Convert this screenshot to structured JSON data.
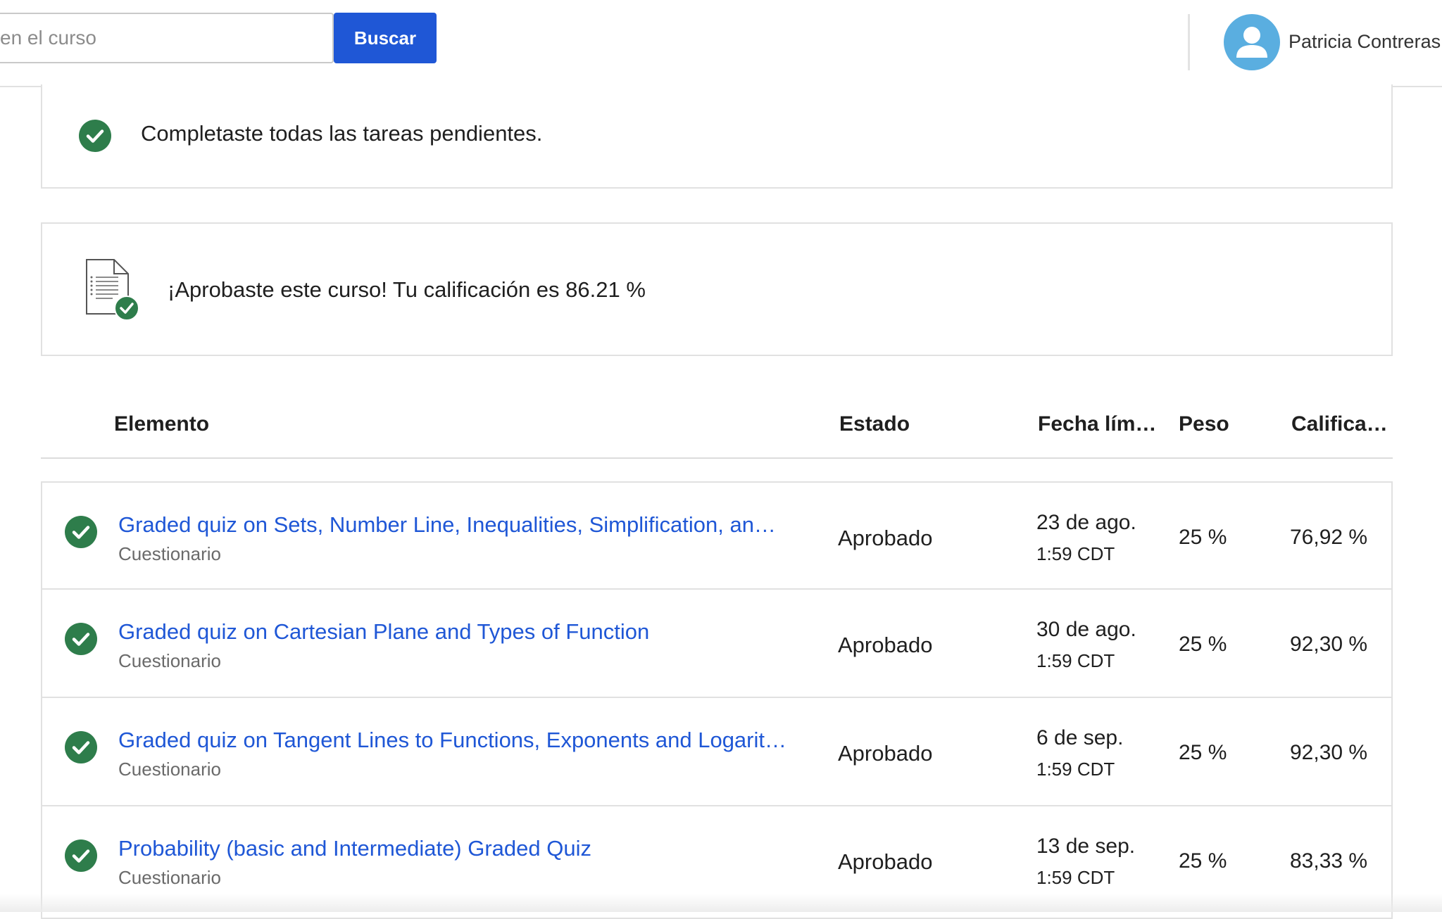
{
  "header": {
    "search_placeholder": "en el curso",
    "search_button": "Buscar",
    "user_name": "Patricia Contreras",
    "avatar_icon": "user-avatar-icon",
    "avatar_color": "#5aaee0"
  },
  "notices": {
    "tasks_message": "Completaste todas las tareas pendientes.",
    "pass_message": "¡Aprobaste este curso! Tu calificación es 86.21 %",
    "check_icon": "check-circle-icon",
    "document_icon": "document-check-icon",
    "success_color": "#2e7d4b"
  },
  "table": {
    "columns": {
      "item": "Elemento",
      "status": "Estado",
      "due": "Fecha lím…",
      "weight": "Peso",
      "grade": "Califica…"
    },
    "rows": [
      {
        "title": "Graded quiz on Sets, Number Line, Inequalities, Simplification, an…",
        "type": "Cuestionario",
        "status": "Aprobado",
        "date": "23 de ago.",
        "time": "1:59 CDT",
        "weight": "25 %",
        "grade": "76,92 %"
      },
      {
        "title": "Graded quiz on Cartesian Plane and Types of Function",
        "type": "Cuestionario",
        "status": "Aprobado",
        "date": "30 de ago.",
        "time": "1:59 CDT",
        "weight": "25 %",
        "grade": "92,30 %"
      },
      {
        "title": "Graded quiz on Tangent Lines to Functions, Exponents and Logarit…",
        "type": "Cuestionario",
        "status": "Aprobado",
        "date": "6 de sep.",
        "time": "1:59 CDT",
        "weight": "25 %",
        "grade": "92,30 %"
      },
      {
        "title": "Probability (basic and Intermediate) Graded Quiz",
        "type": "Cuestionario",
        "status": "Aprobado",
        "date": "13 de sep.",
        "time": "1:59 CDT",
        "weight": "25 %",
        "grade": "83,33 %"
      }
    ],
    "link_color": "#1f57d6"
  }
}
